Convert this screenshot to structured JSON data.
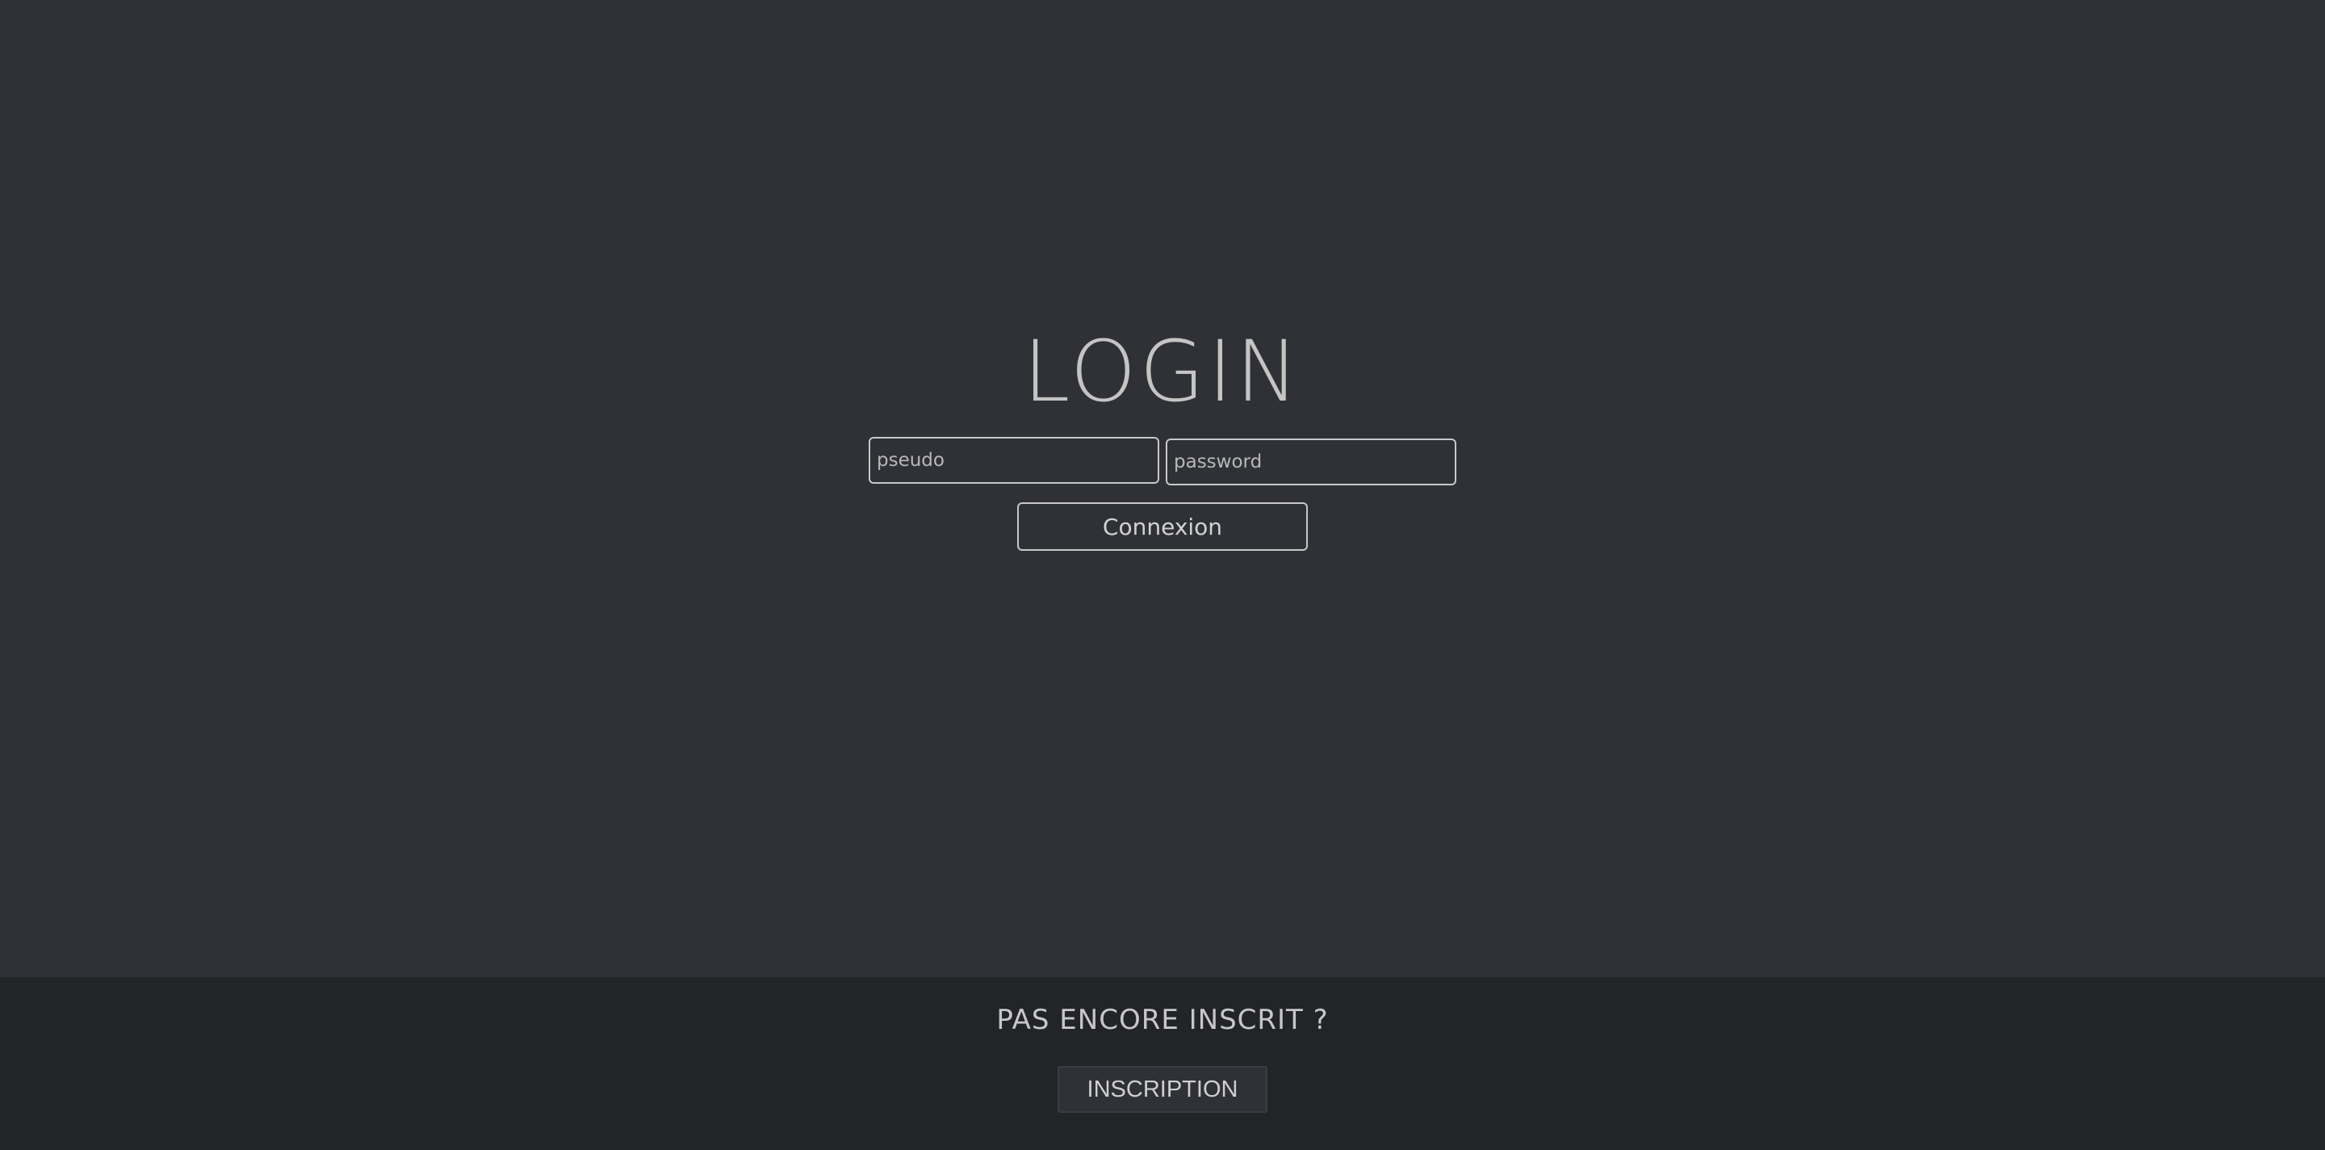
{
  "login": {
    "title": "LOGIN",
    "pseudo_placeholder": "pseudo",
    "password_placeholder": "password",
    "submit_label": "Connexion"
  },
  "signup": {
    "question": "PAS ENCORE INSCRIT ?",
    "button_label": "INSCRIPTION"
  },
  "colors": {
    "background": "#2f3136",
    "footer_background": "#222427",
    "text": "#c9c9c9",
    "border": "#c8c8c8"
  }
}
